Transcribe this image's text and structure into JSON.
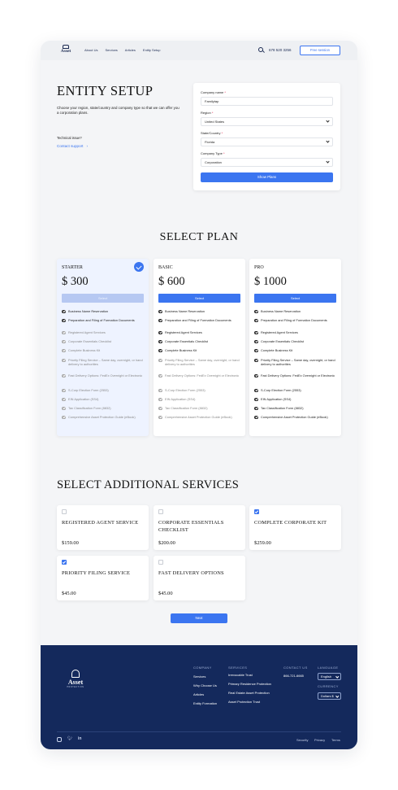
{
  "nav": {
    "logo_text": "Asset",
    "links": [
      "About Us",
      "Services",
      "Articles",
      "Entity Setup"
    ],
    "phone": "678 520 3256",
    "cta": "Free session"
  },
  "entity": {
    "title": "ENTITY SETUP",
    "description_line1": "Choose your region, state/country and company type so that we can offer you",
    "description_line2": "a corporation plans.",
    "tech_issue": "Technical issue?",
    "contact_support": "Contact support",
    "form": {
      "company_name_label": "Company name",
      "company_name_value": "Familytap",
      "region_label": "Region",
      "region_value": "United States",
      "state_label": "State/Country",
      "state_value": "Florida",
      "type_label": "Company Type",
      "type_value": "Corporation",
      "submit": "Show Plans"
    }
  },
  "plans": {
    "title": "SELECT PLAN",
    "items": [
      {
        "name": "STARTER",
        "price": "$ 300",
        "button": "Select",
        "selected": true,
        "features": [
          {
            "text": "Business Name Reservation",
            "included": true
          },
          {
            "text": "Preparation and Filing of Formation Documents",
            "included": true
          },
          {
            "text": "Registered Agent Services",
            "included": false
          },
          {
            "text": "Corporate Essentials Checklist",
            "included": false
          },
          {
            "text": "Complete Business Kit",
            "included": false
          },
          {
            "text": "Priority Filing Service – Same day, overnight, or hand delivery to authorities",
            "included": false
          },
          {
            "text": "Fast Delivery Options: FedEx Overnight or Electronic",
            "included": false
          },
          {
            "text": "S-Corp Election Form (2553)",
            "included": false
          },
          {
            "text": "EIN Application (SS4)",
            "included": false
          },
          {
            "text": "Tax Classification Form (8832)",
            "included": false
          },
          {
            "text": "Comprehensive Asset Protection Guide (eBook)",
            "included": false
          }
        ]
      },
      {
        "name": "BASIC",
        "price": "$ 600",
        "button": "Select",
        "selected": false,
        "features": [
          {
            "text": "Business Name Reservation",
            "included": true
          },
          {
            "text": "Preparation and Filing of Formation Documents",
            "included": true
          },
          {
            "text": "Registered Agent Services",
            "included": true
          },
          {
            "text": "Corporate Essentials Checklist",
            "included": true
          },
          {
            "text": "Complete Business Kit",
            "included": true
          },
          {
            "text": "Priority Filing Service – Same day, overnight, or hand delivery to authorities",
            "included": false
          },
          {
            "text": "Fast Delivery Options: FedEx Overnight or Electronic",
            "included": false
          },
          {
            "text": "S-Corp Election Form (2553)",
            "included": false
          },
          {
            "text": "EIN Application (SS4)",
            "included": false
          },
          {
            "text": "Tax Classification Form (8832)",
            "included": false
          },
          {
            "text": "Comprehensive Asset Protection Guide (eBook)",
            "included": false
          }
        ]
      },
      {
        "name": "PRO",
        "price": "$ 1000",
        "button": "Select",
        "selected": false,
        "features": [
          {
            "text": "Business Name Reservation",
            "included": true
          },
          {
            "text": "Preparation and Filing of Formation Documents",
            "included": true
          },
          {
            "text": "Registered Agent Services",
            "included": true
          },
          {
            "text": "Corporate Essentials Checklist",
            "included": true
          },
          {
            "text": "Complete Business Kit",
            "included": true
          },
          {
            "text": "Priority Filing Service – Same day, overnight, or hand delivery to authorities",
            "included": true
          },
          {
            "text": "Fast Delivery Options: FedEx Overnight or Electronic",
            "included": true
          },
          {
            "text": "S-Corp Election Form (2553)",
            "included": true
          },
          {
            "text": "EIN Application (SS4)",
            "included": true
          },
          {
            "text": "Tax Classification Form (8832)",
            "included": true
          },
          {
            "text": "Comprehensive Asset Protection Guide (eBook)",
            "included": true
          }
        ]
      }
    ]
  },
  "services": {
    "title": "SELECT ADDITIONAL SERVICES",
    "items": [
      {
        "name": "REGISTERED AGENT SERVICE",
        "price": "$159.00",
        "checked": false
      },
      {
        "name": "CORPORATE ESSENTIALS CHECKLIST",
        "price": "$200.00",
        "checked": false
      },
      {
        "name": "COMPLETE CORPORATE KIT",
        "price": "$259.00",
        "checked": true
      },
      {
        "name": "PRIORITY FILING SERVICE",
        "price": "$45.00",
        "checked": true
      },
      {
        "name": "FAST DELIVERY OPTIONS",
        "price": "$45.00",
        "checked": false
      }
    ],
    "next": "Next"
  },
  "footer": {
    "logo_text": "Asset",
    "logo_sub": "PROTECTION",
    "company": {
      "heading": "COMPANY",
      "links": [
        "Services",
        "Why Choose Us",
        "Articles",
        "Entity Formation"
      ]
    },
    "services": {
      "heading": "SERVICES",
      "links": [
        "Irrevocable Trust",
        "Primary Residence Protection",
        "Real Estate Asset Protection",
        "Asset Protection Trust"
      ]
    },
    "contact": {
      "heading": "CONTACT US",
      "phone": "866-721-6665"
    },
    "language": {
      "heading": "LANGUAGE",
      "value": "English"
    },
    "currency": {
      "heading": "CURRENCY",
      "value": "Dollars $"
    },
    "legal": [
      "Security",
      "Privacy",
      "Terms"
    ],
    "social": [
      "instagram-icon",
      "twitter-icon",
      "linkedin-icon"
    ]
  },
  "colors": {
    "accent": "#3b75f0",
    "footer_bg": "#14295c",
    "page_bg": "#f4f5f7"
  }
}
